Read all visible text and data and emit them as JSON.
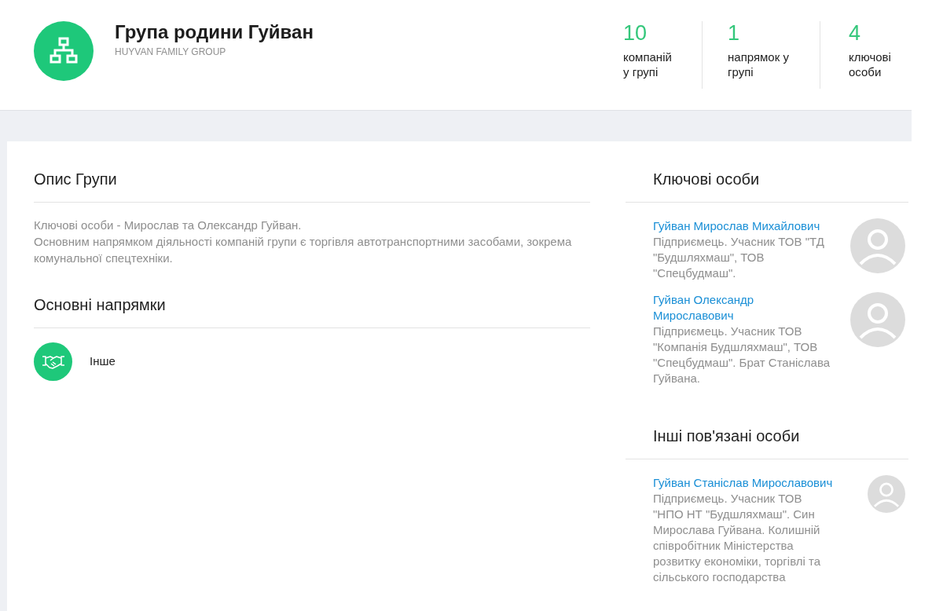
{
  "header": {
    "title": "Група родини Гуйван",
    "subtitle": "HUYVAN FAMILY GROUP"
  },
  "stats": [
    {
      "value": "10",
      "label_lines": [
        "компаній",
        "у групі"
      ]
    },
    {
      "value": "1",
      "label_lines": [
        "напрямок у",
        "групі"
      ]
    },
    {
      "value": "4",
      "label_lines": [
        "ключові",
        "особи"
      ]
    }
  ],
  "description": {
    "title": "Опис Групи",
    "lines": [
      "Ключові особи - Мирослав та Олександр Гуйван.",
      "Основним напрямком діяльності компаній групи є торгівля автотранспортними засобами, зокрема комунальної спецтехніки."
    ]
  },
  "directions": {
    "title": "Основні напрямки",
    "items": [
      {
        "label": "Інше"
      }
    ]
  },
  "key_persons": {
    "title": "Ключові особи",
    "people": [
      {
        "name": "Гуйван Мирослав Михайлович",
        "bio": "Підприємець. Учасник ТОВ \"ТД \"Будшляхмаш\", ТОВ \"Спецбудмаш\"."
      },
      {
        "name": "Гуйван Олександр Мирославович",
        "bio": "Підприємець. Учасник ТОВ \"Компанія Будшляхмаш\", ТОВ \"Спецбудмаш\". Брат Станіслава Гуйвана."
      }
    ]
  },
  "related_persons": {
    "title": "Інші пов'язані особи",
    "people": [
      {
        "name": "Гуйван Станіслав Мирославович",
        "bio": "Підприємець. Учасник ТОВ \"НПО НТ \"Будшляхмаш\". Син Мирослава Гуйвана. Колишній співробітник Міністерства розвитку економіки, торгівлі та сільського господарства"
      }
    ]
  }
}
